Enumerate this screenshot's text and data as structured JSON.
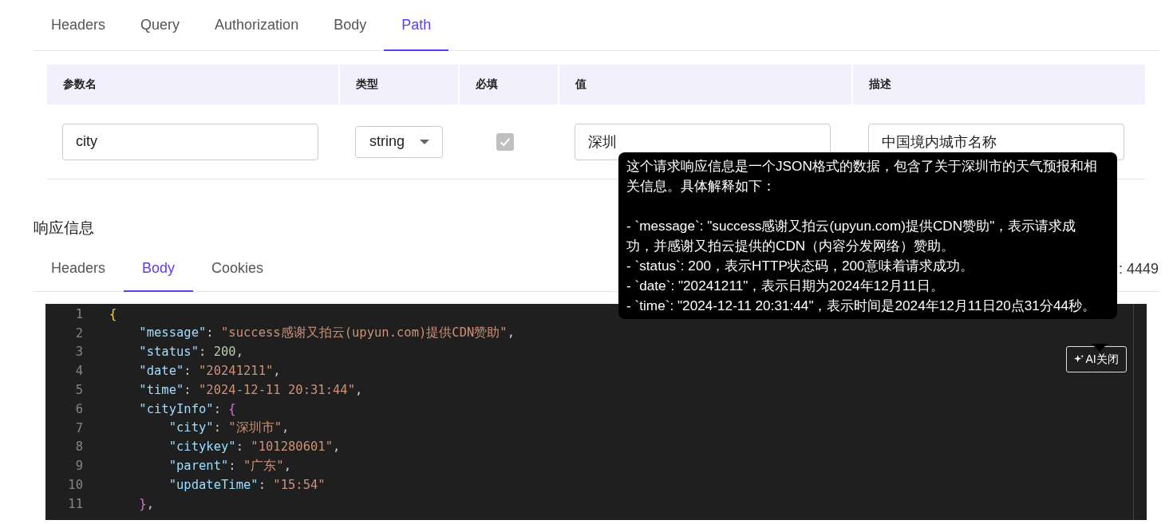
{
  "request_tabs": [
    {
      "label": "Headers",
      "selected": false
    },
    {
      "label": "Query",
      "selected": false
    },
    {
      "label": "Authorization",
      "selected": false
    },
    {
      "label": "Body",
      "selected": false
    },
    {
      "label": "Path",
      "selected": true
    }
  ],
  "params_table": {
    "columns": [
      "参数名",
      "类型",
      "必填",
      "值",
      "描述"
    ],
    "rows": [
      {
        "name": "city",
        "type": "string",
        "required": true,
        "value": "深圳",
        "description": "中国境内城市名称"
      }
    ]
  },
  "response": {
    "title": "响应信息",
    "tabs": [
      {
        "label": "Headers",
        "selected": false
      },
      {
        "label": "Body",
        "selected": true
      },
      {
        "label": "Cookies",
        "selected": false
      }
    ],
    "size_text": ": 4449",
    "code_lines": [
      {
        "number": "1",
        "tokens": [
          {
            "kind": "brace",
            "text": "{"
          }
        ]
      },
      {
        "number": "2",
        "tokens": [
          {
            "kind": "key",
            "text": "    \"message\""
          },
          {
            "kind": "punct",
            "text": ": "
          },
          {
            "kind": "string",
            "text": "\"success感谢又拍云(upyun.com)提供CDN赞助\""
          },
          {
            "kind": "punct",
            "text": ","
          }
        ]
      },
      {
        "number": "3",
        "tokens": [
          {
            "kind": "key",
            "text": "    \"status\""
          },
          {
            "kind": "punct",
            "text": ": "
          },
          {
            "kind": "number",
            "text": "200"
          },
          {
            "kind": "punct",
            "text": ","
          }
        ]
      },
      {
        "number": "4",
        "tokens": [
          {
            "kind": "key",
            "text": "    \"date\""
          },
          {
            "kind": "punct",
            "text": ": "
          },
          {
            "kind": "string",
            "text": "\"20241211\""
          },
          {
            "kind": "punct",
            "text": ","
          }
        ]
      },
      {
        "number": "5",
        "tokens": [
          {
            "kind": "key",
            "text": "    \"time\""
          },
          {
            "kind": "punct",
            "text": ": "
          },
          {
            "kind": "string",
            "text": "\"2024-12-11 20:31:44\""
          },
          {
            "kind": "punct",
            "text": ","
          }
        ]
      },
      {
        "number": "6",
        "tokens": [
          {
            "kind": "key",
            "text": "    \"cityInfo\""
          },
          {
            "kind": "punct",
            "text": ": "
          },
          {
            "kind": "brace2",
            "text": "{"
          }
        ]
      },
      {
        "number": "7",
        "tokens": [
          {
            "kind": "key",
            "text": "        \"city\""
          },
          {
            "kind": "punct",
            "text": ": "
          },
          {
            "kind": "string",
            "text": "\"深圳市\""
          },
          {
            "kind": "punct",
            "text": ","
          }
        ]
      },
      {
        "number": "8",
        "tokens": [
          {
            "kind": "key",
            "text": "        \"citykey\""
          },
          {
            "kind": "punct",
            "text": ": "
          },
          {
            "kind": "string",
            "text": "\"101280601\""
          },
          {
            "kind": "punct",
            "text": ","
          }
        ]
      },
      {
        "number": "9",
        "tokens": [
          {
            "kind": "key",
            "text": "        \"parent\""
          },
          {
            "kind": "punct",
            "text": ": "
          },
          {
            "kind": "string",
            "text": "\"广东\""
          },
          {
            "kind": "punct",
            "text": ","
          }
        ]
      },
      {
        "number": "10",
        "tokens": [
          {
            "kind": "key",
            "text": "        \"updateTime\""
          },
          {
            "kind": "punct",
            "text": ": "
          },
          {
            "kind": "string",
            "text": "\"15:54\""
          }
        ]
      },
      {
        "number": "11",
        "tokens": [
          {
            "kind": "brace2",
            "text": "    }"
          },
          {
            "kind": "punct",
            "text": ","
          }
        ]
      }
    ],
    "ai_button": {
      "label": "AI关闭"
    },
    "ai_tooltip": {
      "paragraphs": [
        "这个请求响应信息是一个JSON格式的数据，包含了关于深圳市的天气预报和相关信息。具体解释如下：",
        "- `message`: \"success感谢又拍云(upyun.com)提供CDN赞助\"，表示请求成功，并感谢又拍云提供的CDN（内容分发网络）赞助。",
        "- `status`: 200，表示HTTP状态码，200意味着请求成功。",
        "- `date`: \"20241211\"，表示日期为2024年12月11日。",
        "- `time`: \"2024-12-11 20:31:44\"，表示时间是2024年12月11日20点31分44秒。"
      ]
    }
  }
}
